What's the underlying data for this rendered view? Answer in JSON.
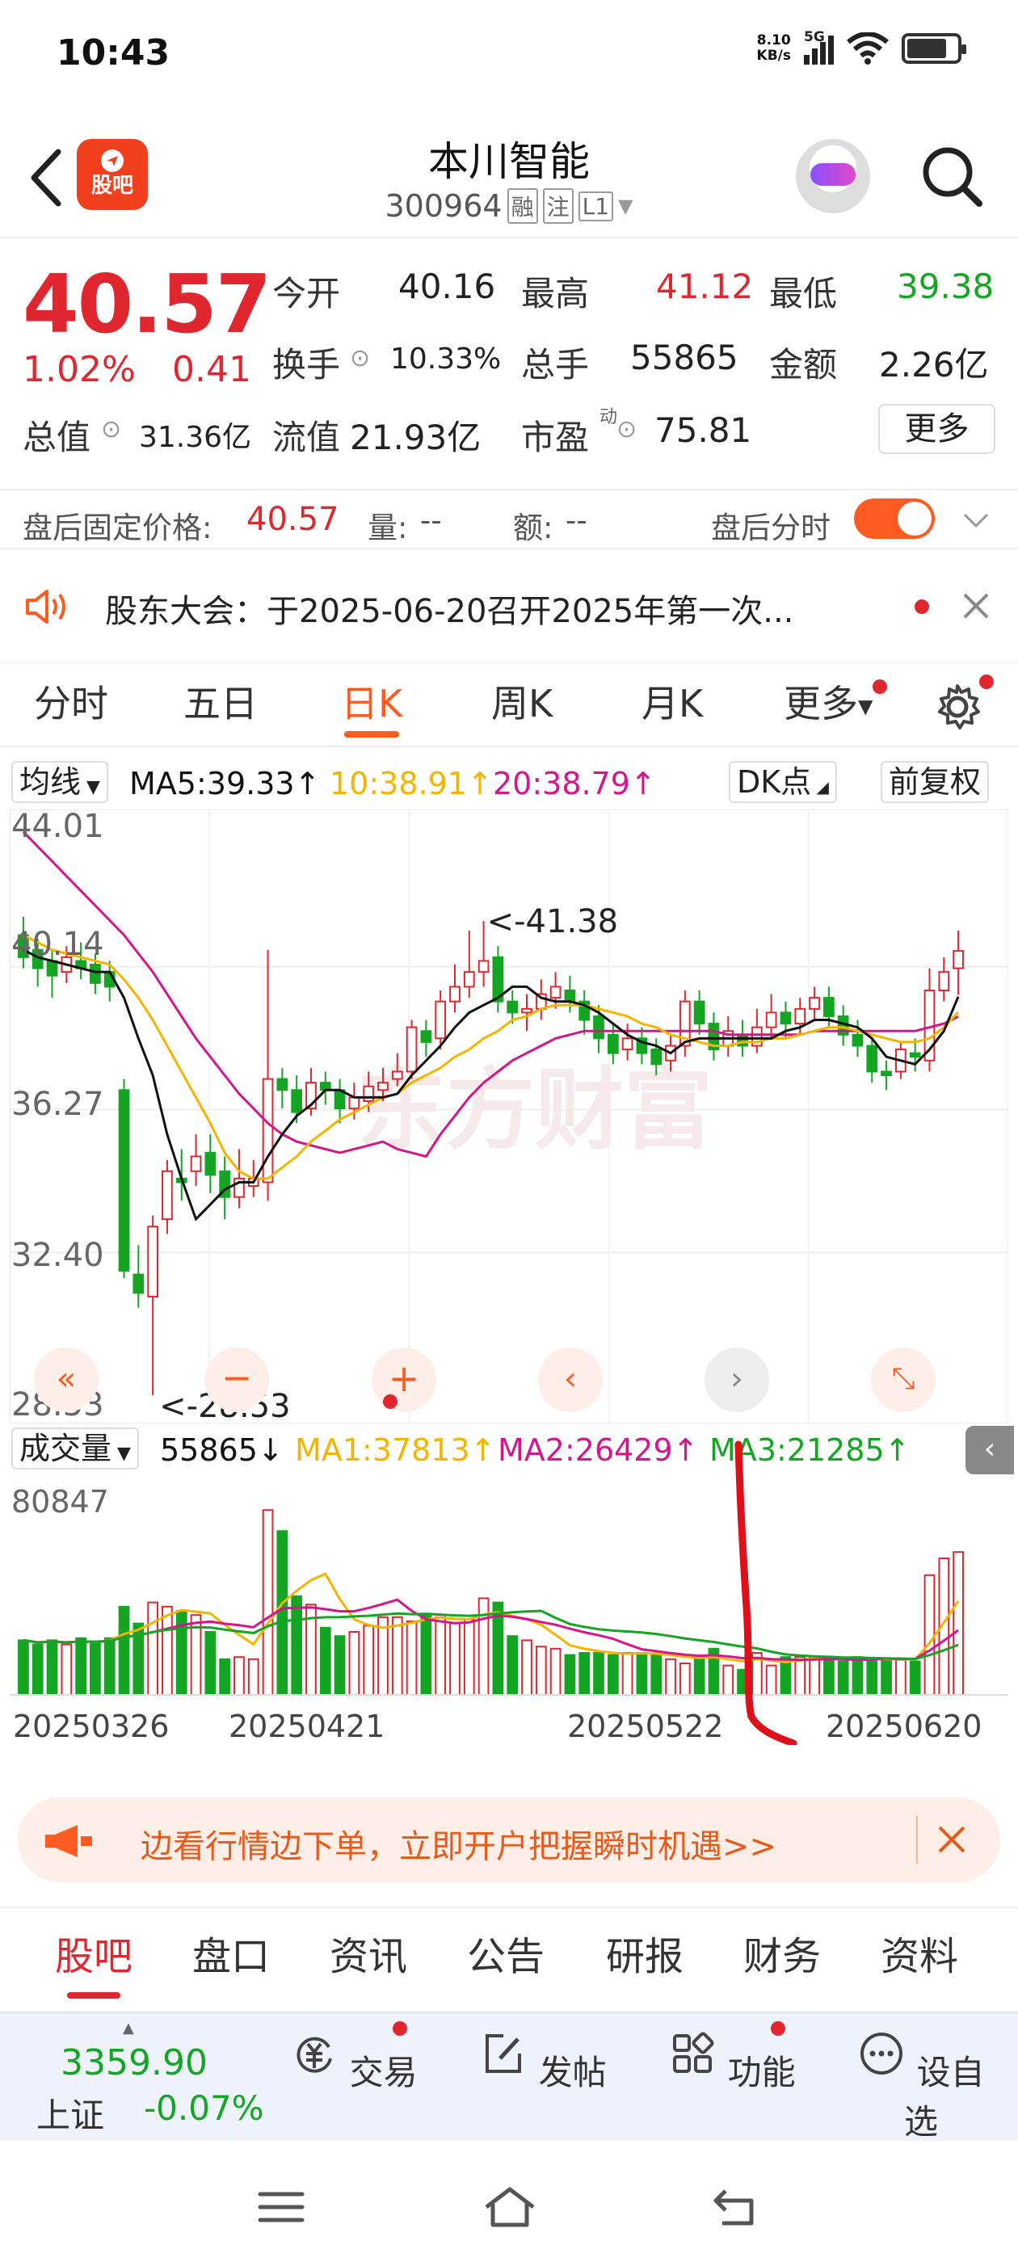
{
  "status": {
    "time": "10:43",
    "net_speed": "8.10",
    "net_unit": "KB/s",
    "signal": "5G",
    "battery_level": 0.8
  },
  "header": {
    "logo_text": "股吧",
    "stock_name": "本川智能",
    "stock_code": "300964",
    "tags": [
      "融",
      "注",
      "L1"
    ]
  },
  "quote": {
    "price": "40.57",
    "change_pct": "1.02%",
    "change_amt": "0.41",
    "open_label": "今开",
    "open": "40.16",
    "high_label": "最高",
    "high": "41.12",
    "low_label": "最低",
    "low": "39.38",
    "turnover_label": "换手",
    "turnover": "10.33%",
    "volume_label": "总手",
    "volume": "55865",
    "amount_label": "金额",
    "amount": "2.26亿",
    "mktcap_label": "总值",
    "mktcap": "31.36亿",
    "float_label": "流值",
    "float": "21.93亿",
    "pe_label": "市盈",
    "pe_sup": "动",
    "pe": "75.81",
    "more": "更多"
  },
  "after_hours": {
    "price_label": "盘后固定价格:",
    "price": "40.57",
    "vol_label": "量:",
    "vol": "--",
    "amt_label": "额:",
    "amt": "--",
    "toggle_label": "盘后分时"
  },
  "notice": {
    "text": "股东大会：于2025-06-20召开2025年第一次..."
  },
  "chart_tabs": [
    "分时",
    "五日",
    "日K",
    "周K",
    "月K",
    "更多"
  ],
  "ma_legend": {
    "selector": "均线",
    "ma5": "MA5:39.33↑",
    "ma10": "10:38.91↑",
    "ma20": "20:38.79↑",
    "dk": "DK点",
    "adjust": "前复权"
  },
  "kline_axis": {
    "labels": [
      "44.01",
      "40.14",
      "36.27",
      "32.40",
      "28.53"
    ]
  },
  "kline_annotations": {
    "high": "<-41.38",
    "low": "<-28.53"
  },
  "volume_legend": {
    "selector": "成交量",
    "value": "55865↓",
    "ma1": "MA1:37813↑",
    "ma2": "MA2:26429↑",
    "ma3": "MA3:21285↑",
    "max": "80847"
  },
  "date_axis": [
    "20250326",
    "20250421",
    "20250522",
    "20250620"
  ],
  "colors": {
    "up": "#e0262e",
    "down": "#14a523",
    "accent": "#ff5a1f",
    "ma5": "#111111",
    "ma10": "#f4b400",
    "ma20": "#d4168c"
  },
  "promo": {
    "text": "边看行情边下单，立即开户把握瞬时机遇>>"
  },
  "bottom_tabs": [
    "股吧",
    "盘口",
    "资讯",
    "公告",
    "研报",
    "财务",
    "资料"
  ],
  "bottom_bar": {
    "index_value": "3359.90",
    "index_name": "上证",
    "index_change": "-0.07%",
    "items": [
      "交易",
      "发帖",
      "功能",
      "设自选"
    ]
  },
  "chart_data": {
    "type": "candlestick",
    "ylim": [
      28.53,
      44.01
    ],
    "candles": [
      [
        41.0,
        40.4,
        41.5,
        40.1
      ],
      [
        40.6,
        40.1,
        40.9,
        39.6
      ],
      [
        40.3,
        39.9,
        40.6,
        39.3
      ],
      [
        40.0,
        40.4,
        40.7,
        39.7
      ],
      [
        40.3,
        40.1,
        40.8,
        39.8
      ],
      [
        40.2,
        39.7,
        40.5,
        39.4
      ],
      [
        40.0,
        39.6,
        40.3,
        39.2
      ],
      [
        36.8,
        31.9,
        37.1,
        31.7
      ],
      [
        31.8,
        31.3,
        32.6,
        30.9
      ],
      [
        31.2,
        33.1,
        33.4,
        28.53
      ],
      [
        33.3,
        34.6,
        34.9,
        32.9
      ],
      [
        34.4,
        34.3,
        35.2,
        33.8
      ],
      [
        34.6,
        35.0,
        35.6,
        34.2
      ],
      [
        35.1,
        34.5,
        35.6,
        34.0
      ],
      [
        34.6,
        33.9,
        35.0,
        33.3
      ],
      [
        33.9,
        34.4,
        35.2,
        33.6
      ],
      [
        34.2,
        34.4,
        34.9,
        33.9
      ],
      [
        34.3,
        37.1,
        40.6,
        33.8
      ],
      [
        37.1,
        36.8,
        37.4,
        36.3
      ],
      [
        36.8,
        36.2,
        37.2,
        35.9
      ],
      [
        36.3,
        37.0,
        37.4,
        36.1
      ],
      [
        37.0,
        36.8,
        37.3,
        36.4
      ],
      [
        36.8,
        36.3,
        37.1,
        35.9
      ],
      [
        36.3,
        36.6,
        37.0,
        36.0
      ],
      [
        36.5,
        36.9,
        37.3,
        36.2
      ],
      [
        36.8,
        37.0,
        37.4,
        36.5
      ],
      [
        37.1,
        37.3,
        37.8,
        36.9
      ],
      [
        37.3,
        38.5,
        38.7,
        37.1
      ],
      [
        38.4,
        38.1,
        38.7,
        37.7
      ],
      [
        38.2,
        39.2,
        39.5,
        37.9
      ],
      [
        39.2,
        39.6,
        40.2,
        38.9
      ],
      [
        39.6,
        40.0,
        41.12,
        39.3
      ],
      [
        40.0,
        40.3,
        41.38,
        39.6
      ],
      [
        40.4,
        39.2,
        40.7,
        38.9
      ],
      [
        39.2,
        38.9,
        39.5,
        38.6
      ],
      [
        38.9,
        39.0,
        39.4,
        38.4
      ],
      [
        39.0,
        39.4,
        39.8,
        38.7
      ],
      [
        39.3,
        39.6,
        40.0,
        39.0
      ],
      [
        39.5,
        39.2,
        39.9,
        38.9
      ],
      [
        39.2,
        38.7,
        39.5,
        38.3
      ],
      [
        38.8,
        38.2,
        39.1,
        37.8
      ],
      [
        38.3,
        37.8,
        38.6,
        37.5
      ],
      [
        37.9,
        38.2,
        38.6,
        37.6
      ],
      [
        38.2,
        37.8,
        38.5,
        37.5
      ],
      [
        37.9,
        37.5,
        38.2,
        37.2
      ],
      [
        37.6,
        38.0,
        38.3,
        37.3
      ],
      [
        38.0,
        39.2,
        39.5,
        37.7
      ],
      [
        39.2,
        38.6,
        39.5,
        38.3
      ],
      [
        38.6,
        37.9,
        38.9,
        37.6
      ],
      [
        38.0,
        38.4,
        38.8,
        37.7
      ],
      [
        38.3,
        38.0,
        38.7,
        37.7
      ],
      [
        38.0,
        38.5,
        39.0,
        37.8
      ],
      [
        38.5,
        38.9,
        39.4,
        38.2
      ],
      [
        38.9,
        38.6,
        39.2,
        38.2
      ],
      [
        38.6,
        39.0,
        39.3,
        38.3
      ],
      [
        39.0,
        39.3,
        39.6,
        38.7
      ],
      [
        39.3,
        38.8,
        39.6,
        38.5
      ],
      [
        38.8,
        38.3,
        39.1,
        38.0
      ],
      [
        38.3,
        38.0,
        38.7,
        37.7
      ],
      [
        38.0,
        37.3,
        38.2,
        37.0
      ],
      [
        37.3,
        37.2,
        37.6,
        36.8
      ],
      [
        37.3,
        37.9,
        38.1,
        37.1
      ],
      [
        37.8,
        37.7,
        38.2,
        37.3
      ],
      [
        37.6,
        39.5,
        40.1,
        37.3
      ],
      [
        39.5,
        40.0,
        40.4,
        39.2
      ],
      [
        40.1,
        40.57,
        41.12,
        39.38
      ]
    ],
    "volumes": [
      0.26,
      0.24,
      0.26,
      0.24,
      0.27,
      0.25,
      0.27,
      0.42,
      0.34,
      0.44,
      0.42,
      0.4,
      0.38,
      0.3,
      0.17,
      0.18,
      0.17,
      0.88,
      0.78,
      0.47,
      0.43,
      0.32,
      0.28,
      0.3,
      0.33,
      0.37,
      0.37,
      0.35,
      0.38,
      0.37,
      0.34,
      0.36,
      0.46,
      0.44,
      0.28,
      0.26,
      0.23,
      0.22,
      0.19,
      0.2,
      0.2,
      0.19,
      0.2,
      0.2,
      0.19,
      0.17,
      0.15,
      0.17,
      0.22,
      0.14,
      0.12,
      0.2,
      0.14,
      0.18,
      0.18,
      0.18,
      0.18,
      0.16,
      0.18,
      0.16,
      0.17,
      0.17,
      0.16,
      0.57,
      0.65,
      0.68
    ],
    "ma5": [
      40.6,
      40.4,
      40.3,
      40.2,
      40.1,
      40.0,
      40.0,
      39.3,
      38.2,
      37.2,
      35.6,
      34.4,
      33.3,
      33.7,
      34.1,
      34.3,
      34.3,
      35.0,
      35.6,
      36.1,
      36.4,
      36.8,
      36.8,
      36.6,
      36.6,
      36.6,
      36.7,
      37.2,
      37.6,
      38.0,
      38.5,
      38.9,
      39.1,
      39.3,
      39.6,
      39.6,
      39.3,
      39.2,
      39.2,
      39.1,
      38.9,
      38.6,
      38.3,
      38.1,
      38.0,
      37.8,
      38.1,
      38.2,
      38.2,
      38.2,
      38.2,
      38.2,
      38.2,
      38.4,
      38.5,
      38.7,
      38.7,
      38.6,
      38.5,
      38.2,
      37.7,
      37.6,
      37.5,
      37.9,
      38.4,
      39.33
    ],
    "ma10": [
      41.0,
      40.8,
      40.6,
      40.5,
      40.4,
      40.3,
      40.2,
      39.8,
      39.3,
      38.7,
      38.0,
      37.3,
      36.6,
      35.9,
      35.1,
      34.6,
      34.4,
      34.4,
      34.7,
      35.0,
      35.4,
      35.7,
      36.0,
      36.2,
      36.4,
      36.6,
      36.7,
      37.0,
      37.2,
      37.4,
      37.7,
      37.9,
      38.2,
      38.4,
      38.7,
      38.8,
      39.0,
      39.1,
      39.1,
      39.1,
      39.0,
      38.9,
      38.8,
      38.6,
      38.5,
      38.3,
      38.2,
      38.1,
      38.0,
      38.0,
      38.1,
      38.1,
      38.2,
      38.2,
      38.3,
      38.4,
      38.5,
      38.5,
      38.4,
      38.3,
      38.2,
      38.1,
      38.1,
      38.2,
      38.5,
      38.91
    ],
    "ma20": [
      43.8,
      43.4,
      43.0,
      42.6,
      42.2,
      41.8,
      41.4,
      41.0,
      40.5,
      40.0,
      39.4,
      38.8,
      38.2,
      37.7,
      37.2,
      36.7,
      36.3,
      35.9,
      35.6,
      35.4,
      35.3,
      35.2,
      35.1,
      35.2,
      35.3,
      35.4,
      35.2,
      35.1,
      35.0,
      35.6,
      36.1,
      36.6,
      37.0,
      37.3,
      37.6,
      37.8,
      38.0,
      38.2,
      38.3,
      38.4,
      38.4,
      38.4,
      38.4,
      38.4,
      38.4,
      38.4,
      38.4,
      38.4,
      38.4,
      38.3,
      38.3,
      38.3,
      38.3,
      38.3,
      38.3,
      38.4,
      38.4,
      38.4,
      38.4,
      38.4,
      38.4,
      38.4,
      38.4,
      38.5,
      38.6,
      38.79
    ]
  }
}
